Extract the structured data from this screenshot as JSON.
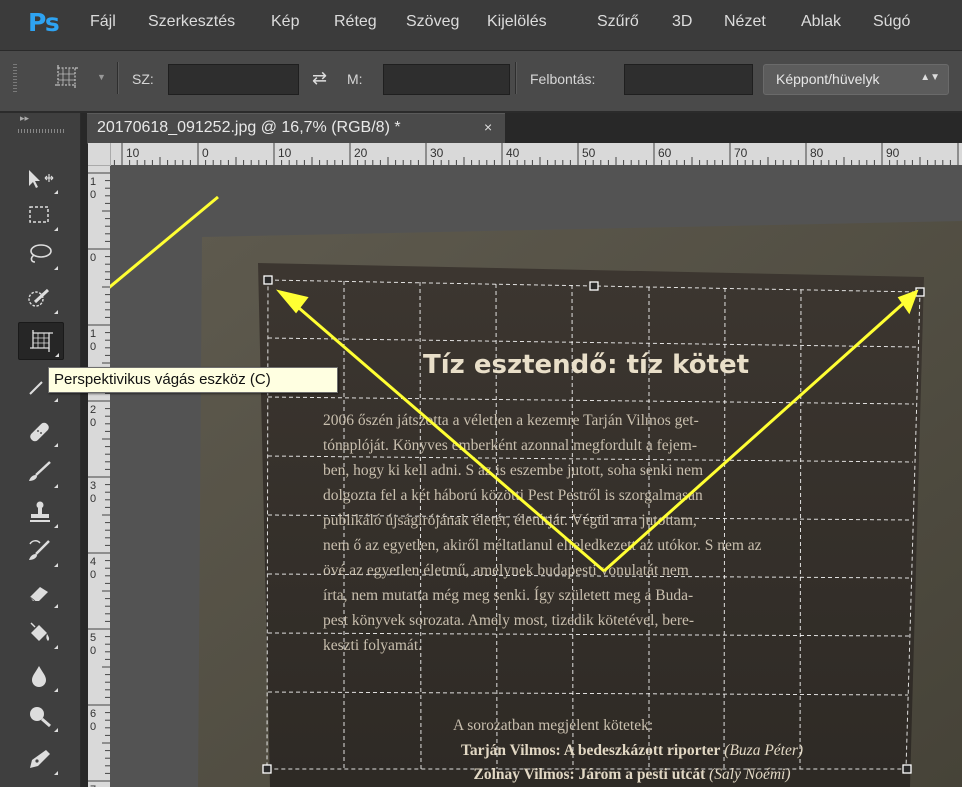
{
  "app": {
    "logo": "Ps",
    "menu": [
      "Fájl",
      "Szerkesztés",
      "Kép",
      "Réteg",
      "Szöveg",
      "Kijelölés",
      "Szűrő",
      "3D",
      "Nézet",
      "Ablak",
      "Súgó"
    ]
  },
  "options_bar": {
    "width_label": "SZ:",
    "width_value": "",
    "height_label": "M:",
    "height_value": "",
    "resolution_label": "Felbontás:",
    "resolution_value": "",
    "unit_select": "Képpont/hüvelyk"
  },
  "document": {
    "tab_title": "20170618_091252.jpg @ 16,7% (RGB/8) *",
    "tab_close": "×"
  },
  "ruler_h_labels": [
    "10",
    "0",
    "10",
    "20",
    "30",
    "40",
    "50",
    "60",
    "70",
    "80",
    "90"
  ],
  "ruler_v_labels": [
    [
      "1",
      "0"
    ],
    [
      "0"
    ],
    [
      "1",
      "0"
    ],
    [
      "2",
      "0"
    ],
    [
      "3",
      "0"
    ],
    [
      "4",
      "0"
    ],
    [
      "5",
      "0"
    ],
    [
      "6",
      "0"
    ],
    [
      "7"
    ]
  ],
  "tools": [
    "move-tool-icon",
    "rectangular-marquee-icon",
    "lasso-icon",
    "quick-selection-icon",
    "perspective-crop-icon",
    "eyedropper-icon",
    "spot-healing-brush-icon",
    "brush-icon",
    "clone-stamp-icon",
    "history-brush-icon",
    "eraser-icon",
    "paint-bucket-icon",
    "blur-icon",
    "dodge-icon",
    "pen-icon"
  ],
  "tooltip": "Perspektivikus vágás eszköz (C)",
  "photo": {
    "heading": "Tíz esztendő: tíz kötet",
    "body_lines": [
      "2006 őszén játszotta a véletlen a kezemre Tarján Vilmos get-",
      "tónaplóját. Könyves emberként azonnal megfordult a fejem-",
      "ben, hogy ki kell adni. S az is eszembe jutott, soha senki nem",
      "dolgozta fel a két háború közötti Pest Pestről is szorgalmasan",
      "publikáló újságírójának életét, életútját. Végül arra jutottam,",
      "nem ő az egyetlen, akiről méltatlanul elfeledkezett az utókor. S nem az",
      "övé az egyetlen életmű, amelynek budapesti vonulatát nem",
      "írta, nem mutatta még meg senki. Így született meg a Buda-",
      "pest könyvek sorozata. Amely most, tizedik kötetével, bere-",
      "keszti folyamát."
    ],
    "list_intro": "A sorozatban megjelent kötetek:",
    "list_items": [
      {
        "bold": "Tarján Vilmos: A bedeszkázott riporter",
        "italic": "(Buza Péter)"
      },
      {
        "bold": "Zolnay Vilmos: Járom a pesti utcát",
        "italic": "(Saly Noémi)"
      }
    ]
  },
  "colors": {
    "accent_logo": "#2ea3f2",
    "annotation_arrow": "#ffff33",
    "tooltip_bg": "#ffffe1"
  }
}
